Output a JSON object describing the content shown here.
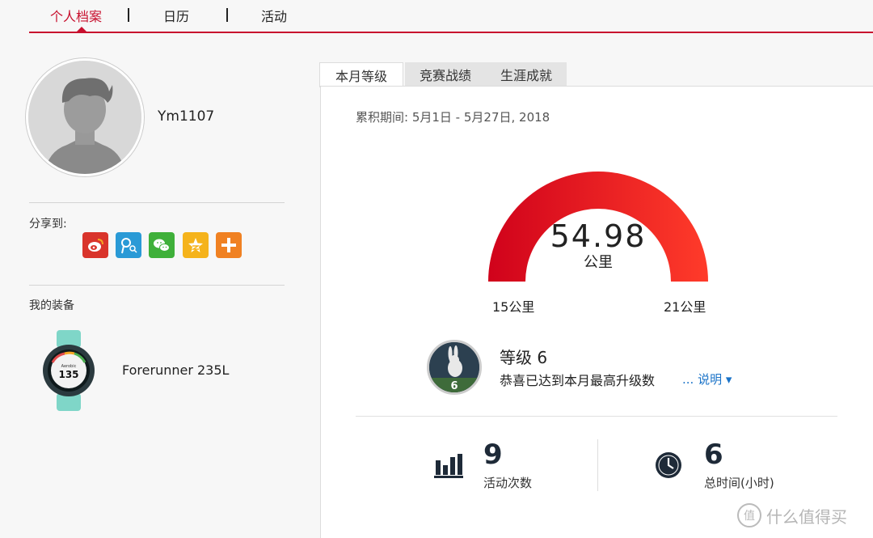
{
  "nav": {
    "tabs": [
      {
        "label": "个人档案",
        "active": true
      },
      {
        "label": "日历",
        "active": false
      },
      {
        "label": "活动",
        "active": false
      }
    ]
  },
  "profile": {
    "username": "Ym1107"
  },
  "share": {
    "label": "分享到:",
    "icons": [
      "weibo-icon",
      "tencent-weibo-icon",
      "wechat-icon",
      "qzone-icon",
      "more-plus-icon"
    ]
  },
  "equipment": {
    "label": "我的装备",
    "device_name": "Forerunner 235L",
    "watch_screen_text": "Aerobic",
    "watch_screen_value": "135"
  },
  "panel_tabs": [
    {
      "label": "本月等级",
      "active": true
    },
    {
      "label": "竞赛战绩",
      "active": false
    },
    {
      "label": "生涯成就",
      "active": false
    }
  ],
  "period": "累积期间: 5月1日 - 5月27日, 2018",
  "gauge": {
    "value": "54.98",
    "unit": "公里",
    "min_label": "15公里",
    "max_label": "21公里",
    "color_start": "#d0021b",
    "color_end": "#ff3b2a"
  },
  "level": {
    "badge_number": "6",
    "title": "等级 6",
    "description": "恭喜已达到本月最高升级数",
    "link": "... 说明 ▾"
  },
  "stats": [
    {
      "icon": "bar-chart-icon",
      "value": "9",
      "label": "活动次数"
    },
    {
      "icon": "clock-icon",
      "value": "6",
      "label": "总时间(小时)"
    }
  ],
  "watermark": {
    "glyph": "值",
    "text": "什么值得买"
  },
  "colors": {
    "accent": "#c8102e",
    "link": "#1a73c8"
  }
}
